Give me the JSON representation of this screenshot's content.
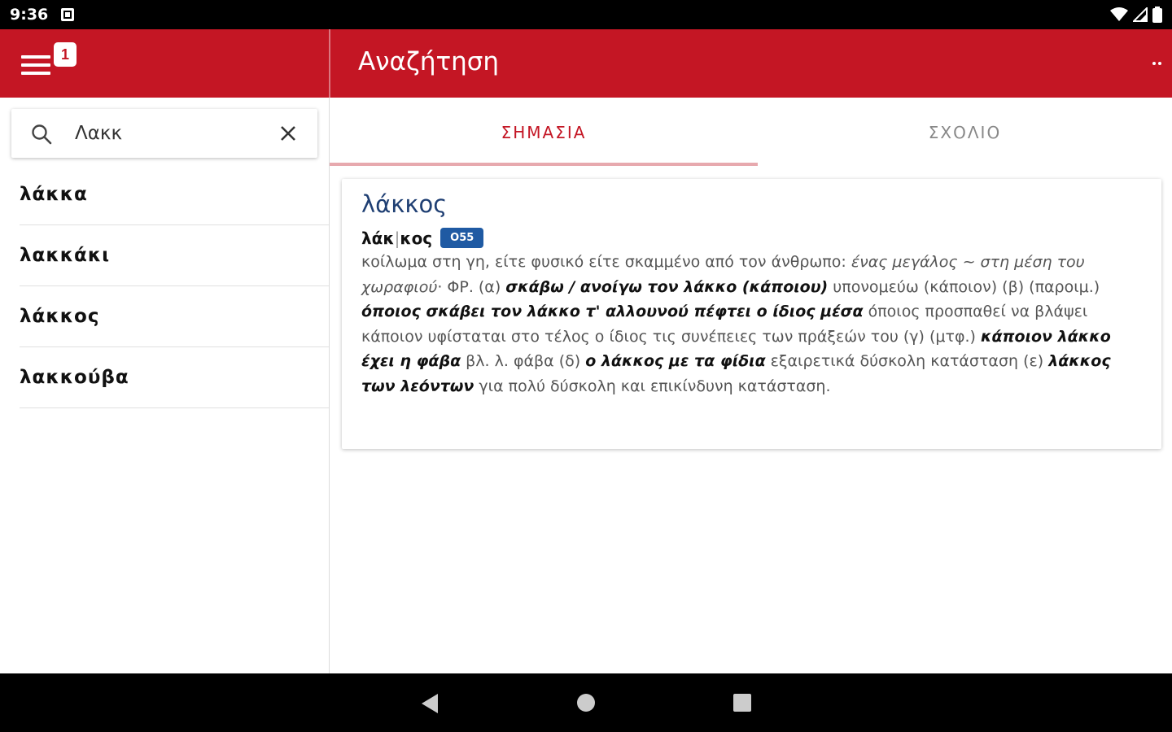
{
  "status_bar": {
    "time": "9:36"
  },
  "appbar": {
    "badge_count": "1",
    "title": "Αναζήτηση"
  },
  "search": {
    "value": "Λακκ",
    "placeholder": ""
  },
  "results": [
    {
      "label": "λάκκα"
    },
    {
      "label": "λακκάκι"
    },
    {
      "label": "λάκκος"
    },
    {
      "label": "λακκούβα"
    }
  ],
  "tabs": [
    {
      "label": "ΣΗΜΑΣΙΑ",
      "active": true
    },
    {
      "label": "ΣΧΟΛΙΟ",
      "active": false
    }
  ],
  "entry": {
    "title": "λάκκος",
    "headword_part1": "λάκ",
    "headword_part2": "κος",
    "code": "O55",
    "definition": [
      {
        "t": "n",
        "v": "κοίλωμα στη γη, είτε φυσικό είτε σκαμμένο από τον άνθρωπο: "
      },
      {
        "t": "i",
        "v": "ένας μεγάλος ~ στη μέση του χωραφιού"
      },
      {
        "t": "n",
        "v": "· ΦΡ. (α) "
      },
      {
        "t": "b",
        "v": "σκάβω / ανοίγω τον λάκκο (κάποιου)"
      },
      {
        "t": "n",
        "v": " υπονομεύω (κάποιον) (β) (παροιμ.) "
      },
      {
        "t": "b",
        "v": "όποιος σκάβει τον λάκκο τ' αλλουνού πέφτει ο ίδιος μέσα"
      },
      {
        "t": "n",
        "v": " όποιος προσπαθεί να βλάψει κάποιον υφίσταται στο τέλος ο ίδιος τις συνέπειες των πράξεών του (γ) (μτφ.) "
      },
      {
        "t": "b",
        "v": "κάποιον λάκκο έχει η φάβα"
      },
      {
        "t": "n",
        "v": " βλ. λ. φάβα (δ) "
      },
      {
        "t": "b",
        "v": "ο λάκκος με τα φίδια"
      },
      {
        "t": "n",
        "v": " εξαιρετικά δύσκολη κατάσταση (ε) "
      },
      {
        "t": "b",
        "v": "λάκκος των λεόντων"
      },
      {
        "t": "n",
        "v": " για πολύ δύσκολη και επικίνδυνη κατάσταση."
      }
    ]
  },
  "colors": {
    "brand": "#c41624",
    "title_blue": "#1f3f73",
    "badge_blue": "#1f5aa3"
  }
}
